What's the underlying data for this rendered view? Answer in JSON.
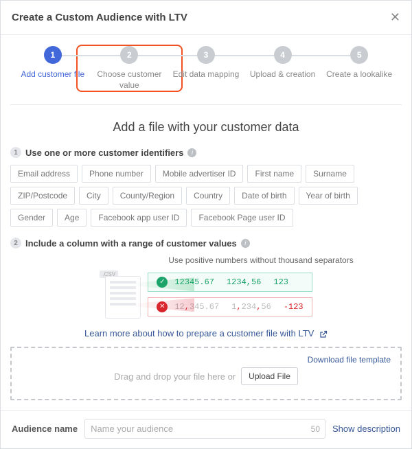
{
  "header": {
    "title": "Create a Custom Audience with LTV"
  },
  "steps": [
    {
      "num": "1",
      "label": "Add customer file"
    },
    {
      "num": "2",
      "label": "Choose customer value"
    },
    {
      "num": "3",
      "label": "Edit data mapping"
    },
    {
      "num": "4",
      "label": "Upload & creation"
    },
    {
      "num": "5",
      "label": "Create a lookalike"
    }
  ],
  "main": {
    "title": "Add a file with your customer data",
    "sub1": "Use one or more customer identifiers",
    "sub2": "Include a column with a range of customer values",
    "hint": "Use positive numbers without thousand separators",
    "learn_more": "Learn more about how to prepare a customer file with LTV",
    "download_template": "Download file template",
    "drop_text": "Drag and drop your file here or",
    "upload_btn": "Upload File"
  },
  "identifiers": [
    "Email address",
    "Phone number",
    "Mobile advertiser ID",
    "First name",
    "Surname",
    "ZIP/Postcode",
    "City",
    "County/Region",
    "Country",
    "Date of birth",
    "Year of birth",
    "Gender",
    "Age",
    "Facebook app user ID",
    "Facebook Page user ID"
  ],
  "example": {
    "good": [
      "12345.67",
      "1234,56",
      "123"
    ],
    "bad": [
      "12,345.67",
      "1,234,56",
      "-123"
    ]
  },
  "footer": {
    "label": "Audience name",
    "placeholder": "Name your audience",
    "maxlength": "50",
    "show_description": "Show description"
  }
}
